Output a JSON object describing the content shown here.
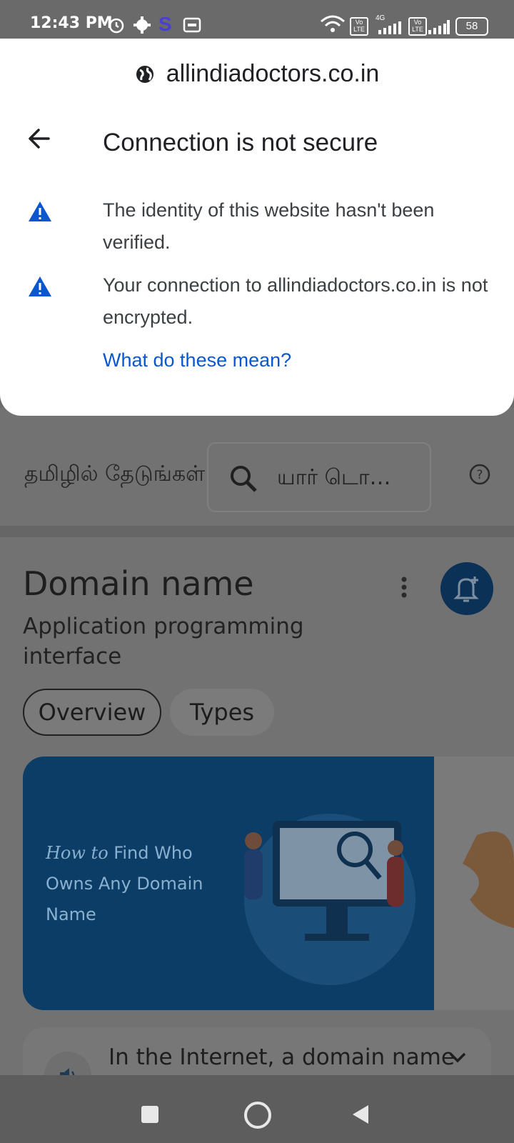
{
  "status_bar": {
    "time": "12:43 PM",
    "battery": "58",
    "network": "4G"
  },
  "security_sheet": {
    "domain": "allindiadoctors.co.in",
    "title": "Connection is not secure",
    "warnings": [
      "The identity of this website hasn't been verified.",
      "Your connection to allindiadoctors.co.in is not encrypted."
    ],
    "link": "What do these mean?",
    "accent_color": "#0b57d0"
  },
  "background_page": {
    "search_label": "தமிழில் தேடுங்கள்",
    "search_query": "யார் டொ…",
    "panel_title": "Domain name",
    "panel_subtitle": "Application programming interface",
    "tabs": [
      "Overview",
      "Types"
    ],
    "card_text": [
      "How to",
      "Find Who Owns Any Domain Name"
    ],
    "expander_text": "In the Internet, a domain name"
  }
}
